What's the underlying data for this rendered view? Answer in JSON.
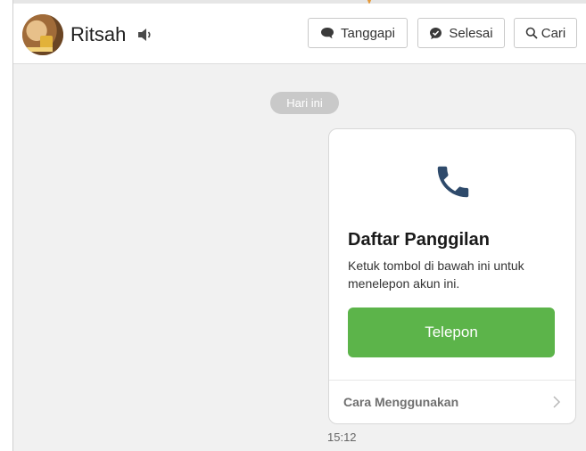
{
  "header": {
    "contact_name": "Ritsah",
    "buttons": {
      "reply": "Tanggapi",
      "done": "Selesai",
      "search": "Cari"
    }
  },
  "chat": {
    "date_separator": "Hari ini",
    "card": {
      "title": "Daftar Panggilan",
      "description": "Ketuk tombol di bawah ini untuk menelepon akun ini.",
      "call_button": "Telepon",
      "footer_link": "Cara Menggunakan"
    },
    "timestamp": "15:12"
  },
  "colors": {
    "accent_green": "#5cb44a",
    "phone_icon": "#2e4a6b",
    "pill_gray": "#c9c9c9",
    "background": "#f1f1f1"
  },
  "icons": {
    "speaker": "speaker-icon",
    "reply": "speech-bubble-icon",
    "done": "check-bubble-icon",
    "search": "search-icon",
    "phone": "phone-icon",
    "chevron": "chevron-right-icon"
  }
}
